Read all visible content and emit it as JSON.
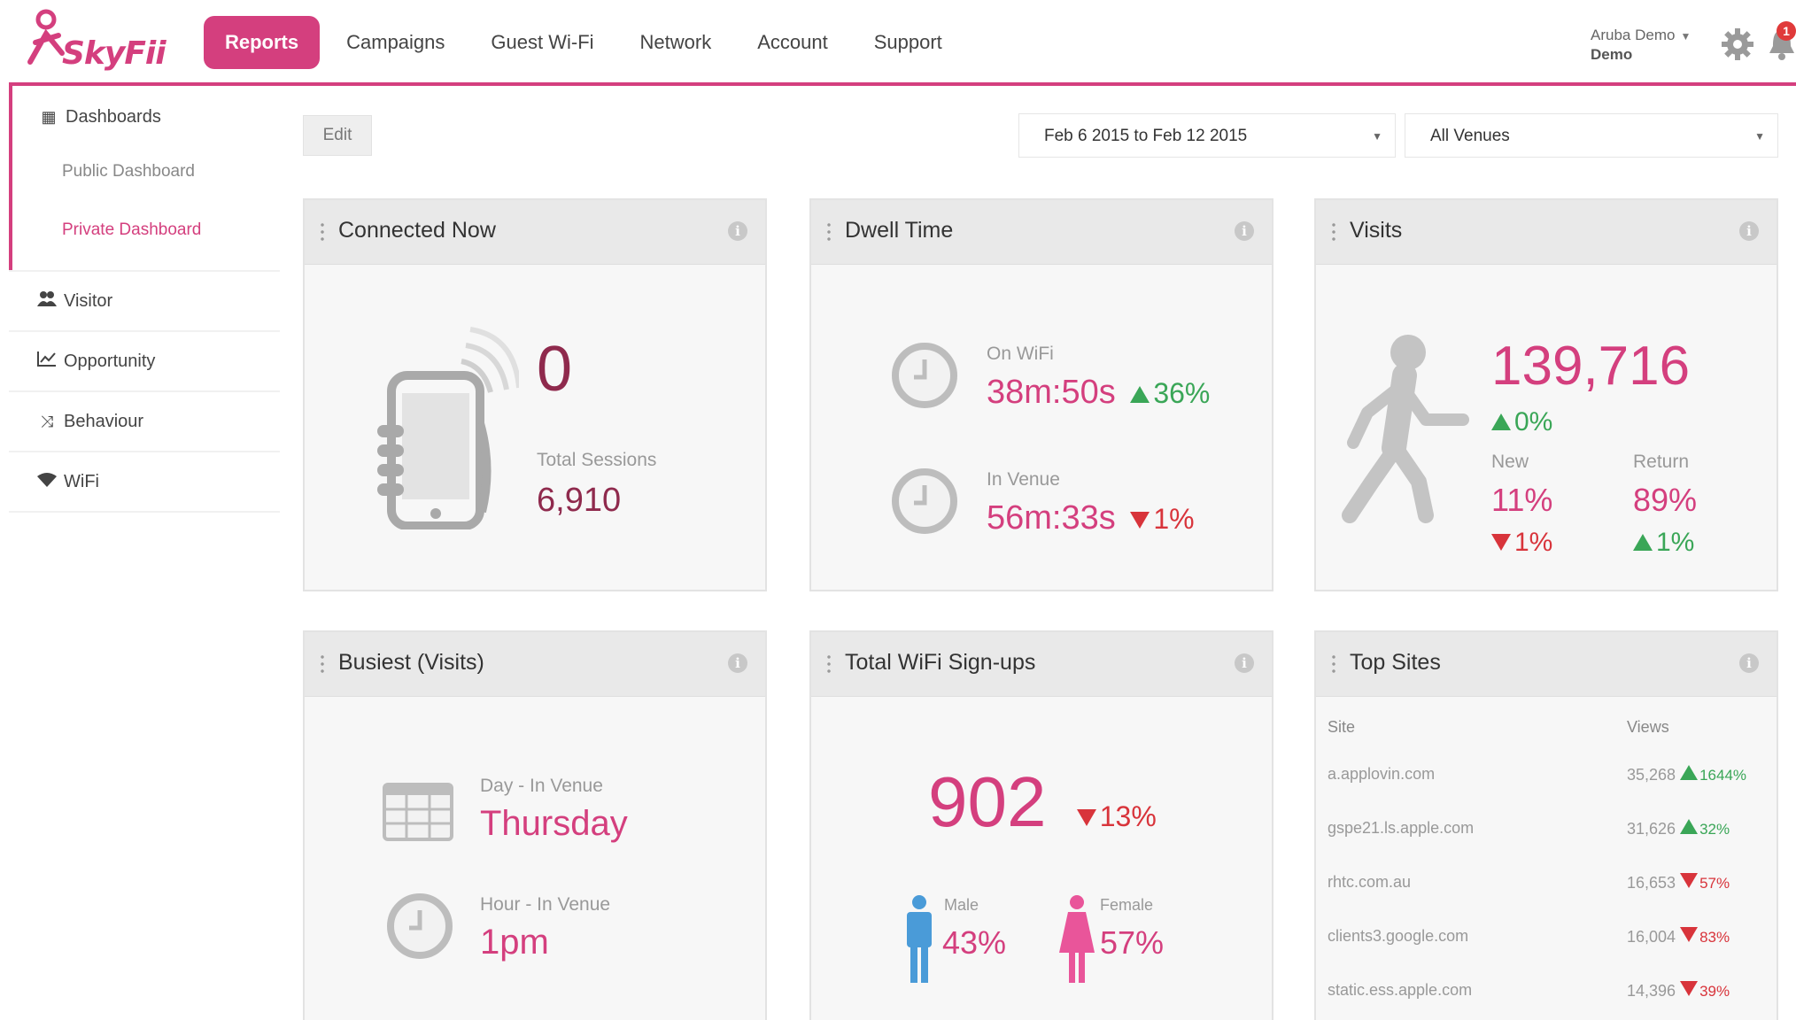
{
  "app": {
    "logo_text": "SkyFii"
  },
  "nav": {
    "items": [
      "Reports",
      "Campaigns",
      "Guest Wi-Fi",
      "Network",
      "Account",
      "Support"
    ],
    "active": "Reports"
  },
  "user": {
    "name": "Aruba Demo",
    "sub": "Demo",
    "notification_count": "1"
  },
  "sidebar": {
    "group_label": "Dashboards",
    "sub_items": [
      "Public Dashboard",
      "Private Dashboard"
    ],
    "active_sub": "Private Dashboard",
    "items": [
      {
        "label": "Visitor",
        "icon": "users-icon"
      },
      {
        "label": "Opportunity",
        "icon": "line-chart-icon"
      },
      {
        "label": "Behaviour",
        "icon": "shuffle-icon"
      },
      {
        "label": "WiFi",
        "icon": "wifi-icon"
      }
    ]
  },
  "toolbar": {
    "edit_label": "Edit",
    "date_range": "Feb 6 2015 to Feb 12 2015",
    "venue": "All Venues"
  },
  "cards": {
    "connected_now": {
      "title": "Connected Now",
      "value": "0",
      "sessions_label": "Total Sessions",
      "sessions_value": "6,910"
    },
    "dwell_time": {
      "title": "Dwell Time",
      "wifi_label": "On WiFi",
      "wifi_value": "38m:50s",
      "wifi_delta": "36%",
      "wifi_trend": "up",
      "venue_label": "In Venue",
      "venue_value": "56m:33s",
      "venue_delta": "1%",
      "venue_trend": "down"
    },
    "visits": {
      "title": "Visits",
      "value": "139,716",
      "delta": "0%",
      "trend": "up",
      "new_label": "New",
      "new_value": "11%",
      "new_delta": "1%",
      "new_trend": "down",
      "return_label": "Return",
      "return_value": "89%",
      "return_delta": "1%",
      "return_trend": "up"
    },
    "busiest": {
      "title": "Busiest (Visits)",
      "day_label": "Day - In Venue",
      "day_value": "Thursday",
      "hour_label": "Hour - In Venue",
      "hour_value": "1pm"
    },
    "signups": {
      "title": "Total WiFi Sign-ups",
      "value": "902",
      "delta": "13%",
      "trend": "down",
      "male_label": "Male",
      "male_value": "43%",
      "female_label": "Female",
      "female_value": "57%"
    },
    "top_sites": {
      "title": "Top Sites",
      "col_site": "Site",
      "col_views": "Views",
      "rows": [
        {
          "site": "a.applovin.com",
          "views": "35,268",
          "delta": "1644%",
          "trend": "up"
        },
        {
          "site": "gspe21.ls.apple.com",
          "views": "31,626",
          "delta": "32%",
          "trend": "up"
        },
        {
          "site": "rhtc.com.au",
          "views": "16,653",
          "delta": "57%",
          "trend": "down"
        },
        {
          "site": "clients3.google.com",
          "views": "16,004",
          "delta": "83%",
          "trend": "down"
        },
        {
          "site": "static.ess.apple.com",
          "views": "14,396",
          "delta": "39%",
          "trend": "down"
        }
      ]
    }
  },
  "colors": {
    "brand": "#d43f7e",
    "value_dark": "#8f2a4d",
    "up": "#3aa657",
    "down": "#d8343b",
    "male": "#4a9bd8",
    "female": "#e9559a"
  }
}
